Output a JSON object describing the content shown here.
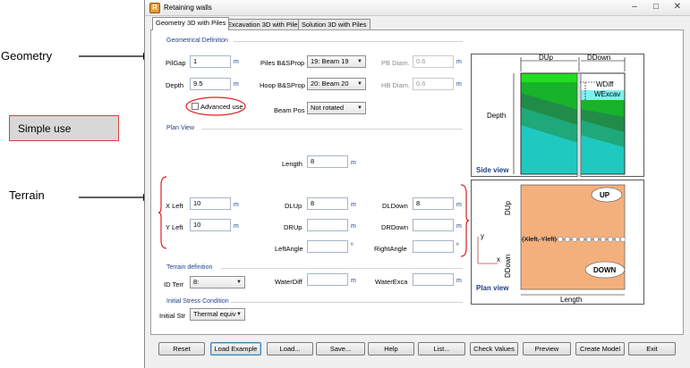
{
  "annotations": {
    "geometry": "Geometry",
    "simple_use": "Simple use",
    "terrain": "Terrain"
  },
  "window": {
    "title": "Retaining walls",
    "minimize": "–",
    "maximize": "□",
    "close": "✕"
  },
  "tabs": [
    "Geometry 3D with Piles",
    "Excavation 3D with Piles",
    "Solution 3D with Piles"
  ],
  "geometry": {
    "section": "Geometrical Definition",
    "pilgap_label": "PilGap",
    "pilgap": "1",
    "depth_label": "Depth",
    "depth": "9.5",
    "piles_label": "Piles B&SProp",
    "piles": "19: Beam 19",
    "hoop_label": "Hoop B&SProp",
    "hoop": "20: Beam 20",
    "pb_label": "PB Diam.",
    "pb": "0.6",
    "hb_label": "HB Diam.",
    "hb": "0.6",
    "advanced_label": "Advanced use",
    "beampos_label": "Beam Pos",
    "beampos": "Not rotated",
    "unit_m": "m"
  },
  "plan": {
    "section": "Plan View",
    "length_label": "Length",
    "length": "8",
    "xleft_label": "X Left",
    "xleft": "10",
    "yleft_label": "Y Left",
    "yleft": "10",
    "dlup_label": "DLUp",
    "dlup": "8",
    "drup_label": "DRUp",
    "drup": "",
    "leftangle_label": "LeftAngle",
    "leftangle": "",
    "dldown_label": "DLDown",
    "dldown": "8",
    "drdown_label": "DRDown",
    "drdown": "",
    "rightangle_label": "RightAngle",
    "rightangle": "",
    "unit_deg": "º"
  },
  "terrain": {
    "section": "Terrain definition",
    "idterr_label": "ID Terr",
    "idterr": "8:",
    "waterdiff_label": "WaterDiff",
    "waterdiff": "",
    "waterexca_label": "WaterExca",
    "waterexca": ""
  },
  "stress": {
    "section": "Initial Stress Condition",
    "initstr_label": "Initial Str",
    "initstr": "Thermal equiv"
  },
  "side_view": {
    "caption": "Side view",
    "dup": "DUp",
    "ddown": "DDown",
    "depth": "Depth",
    "wdiff": "WDiff",
    "wexcav": "WExcav"
  },
  "plan_view": {
    "caption": "Plan view",
    "up": "UP",
    "down": "DOWN",
    "dup": "DUp",
    "ddown": "DDown",
    "coords": "(Xleft, Yleft)",
    "length": "Length",
    "axis_y": "y",
    "axis_x": "x"
  },
  "buttons": {
    "reset": "Reset",
    "load_example": "Load Example",
    "load": "Load...",
    "save": "Save...",
    "help": "Help",
    "list": "List...",
    "check": "Check Values",
    "preview": "Preview",
    "create": "Create Model",
    "exit": "Exit"
  },
  "colors": {
    "section_blue": "#1f3f8a",
    "annotation_red": "#d84040",
    "plan_fill": "#f4b07c",
    "green_top": "#22dd22",
    "water_cyan": "#80f0f0"
  }
}
